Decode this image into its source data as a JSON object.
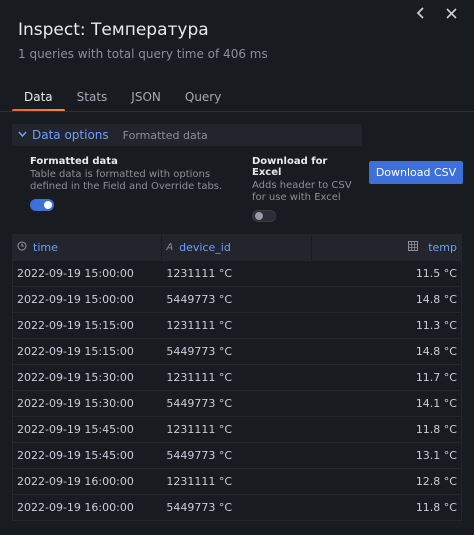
{
  "drawer": {
    "title": "Inspect: Температура",
    "subtitle": "1 queries with total query time of 406 ms"
  },
  "header_actions": {
    "expand_icon": "chevron-left-icon",
    "close_icon": "close-icon"
  },
  "tabs": [
    {
      "label": "Data",
      "active": true
    },
    {
      "label": "Stats",
      "active": false
    },
    {
      "label": "JSON",
      "active": false
    },
    {
      "label": "Query",
      "active": false
    }
  ],
  "options": {
    "section_label": "Data options",
    "section_summary": "Formatted data",
    "formatted": {
      "title": "Formatted data",
      "description": "Table data is formatted with options defined in the Field and Override tabs.",
      "enabled": true
    },
    "excel": {
      "title": "Download for Excel",
      "description": "Adds header to CSV for use with Excel",
      "enabled": false
    },
    "download_label": "Download CSV"
  },
  "table": {
    "columns": [
      {
        "label": "time",
        "icon": "clock-icon"
      },
      {
        "label": "device_id",
        "icon": "text-type-icon"
      },
      {
        "label": "temp",
        "icon": "number-type-icon"
      }
    ],
    "rows": [
      [
        "2022-09-19 15:00:00",
        "1231111 °C",
        "11.5 °C"
      ],
      [
        "2022-09-19 15:00:00",
        "5449773 °C",
        "14.8 °C"
      ],
      [
        "2022-09-19 15:15:00",
        "1231111 °C",
        "11.3 °C"
      ],
      [
        "2022-09-19 15:15:00",
        "5449773 °C",
        "14.8 °C"
      ],
      [
        "2022-09-19 15:30:00",
        "1231111 °C",
        "11.7 °C"
      ],
      [
        "2022-09-19 15:30:00",
        "5449773 °C",
        "14.1 °C"
      ],
      [
        "2022-09-19 15:45:00",
        "1231111 °C",
        "11.8 °C"
      ],
      [
        "2022-09-19 15:45:00",
        "5449773 °C",
        "13.1 °C"
      ],
      [
        "2022-09-19 16:00:00",
        "1231111 °C",
        "12.8 °C"
      ],
      [
        "2022-09-19 16:00:00",
        "5449773 °C",
        "11.8 °C"
      ]
    ]
  }
}
